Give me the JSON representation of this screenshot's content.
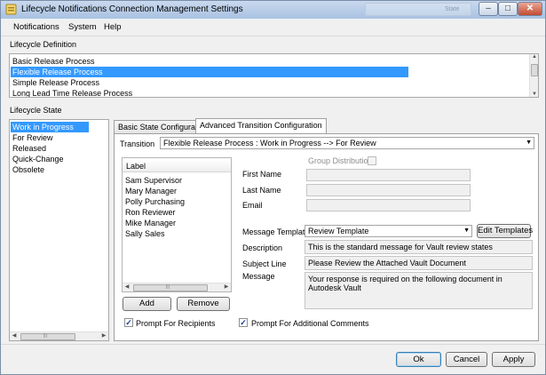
{
  "window": {
    "title": "Lifecycle Notifications Connection Management Settings",
    "ghost_label": "State",
    "minimize_glyph": "–",
    "maximize_glyph": "□",
    "close_glyph": "✕"
  },
  "menu": {
    "items": [
      "Notifications",
      "System",
      "Help"
    ]
  },
  "lifecycle_definition": {
    "label": "Lifecycle Definition",
    "items": [
      {
        "label": "Basic Release Process",
        "selected": false
      },
      {
        "label": "Flexible Release Process",
        "selected": true
      },
      {
        "label": "Simple Release Process",
        "selected": false
      },
      {
        "label": "Long Lead Time Release Process",
        "selected": false
      }
    ]
  },
  "lifecycle_state": {
    "label": "Lifecycle State",
    "items": [
      {
        "label": "Work in Progress",
        "selected": true
      },
      {
        "label": "For Review",
        "selected": false
      },
      {
        "label": "Released",
        "selected": false
      },
      {
        "label": "Quick-Change",
        "selected": false
      },
      {
        "label": "Obsolete",
        "selected": false
      }
    ]
  },
  "tabs": [
    {
      "label": "Basic State Configuration",
      "active": false
    },
    {
      "label": "Advanced Transition Configuration",
      "active": true
    }
  ],
  "transition": {
    "label": "Transition",
    "value": "Flexible Release Process : Work in Progress --> For Review"
  },
  "recipients": {
    "column_header": "Label",
    "items": [
      "Sam Supervisor",
      "Mary Manager",
      "Polly Purchasing",
      "Ron Reviewer",
      "Mike Manager",
      "Sally Sales"
    ],
    "add_label": "Add",
    "remove_label": "Remove"
  },
  "group_distribution": {
    "label": "Group Distribution",
    "checked": false
  },
  "contact_fields": {
    "first_name_label": "First Name",
    "last_name_label": "Last Name",
    "email_label": "Email",
    "first_name_value": "",
    "last_name_value": "",
    "email_value": ""
  },
  "message": {
    "template_label": "Message Template",
    "template_value": "Review Template",
    "edit_templates_label": "Edit Templates",
    "description_label": "Description",
    "description_value": "This is the standard message for Vault review states",
    "subject_label": "Subject Line",
    "subject_value": "Please Review the Attached Vault Document",
    "message_label": "Message",
    "message_value": "Your response is required on the following document in Autodesk Vault"
  },
  "options": {
    "prompt_recipients_label": "Prompt For Recipients",
    "prompt_recipients_checked": true,
    "prompt_comments_label": "Prompt For Additional Comments",
    "prompt_comments_checked": true,
    "check_glyph": "✓"
  },
  "footer": {
    "ok_label": "Ok",
    "cancel_label": "Cancel",
    "apply_label": "Apply"
  },
  "scroll_glyphs": {
    "up": "▲",
    "down": "▼",
    "left": "◀",
    "right": "▶",
    "combo": "▼",
    "grip": "|||"
  },
  "colors": {
    "selection": "#3399ff",
    "titlebar_top": "#c9d9ee",
    "titlebar_bottom": "#a9c1e1",
    "close_button": "#c24d31"
  }
}
